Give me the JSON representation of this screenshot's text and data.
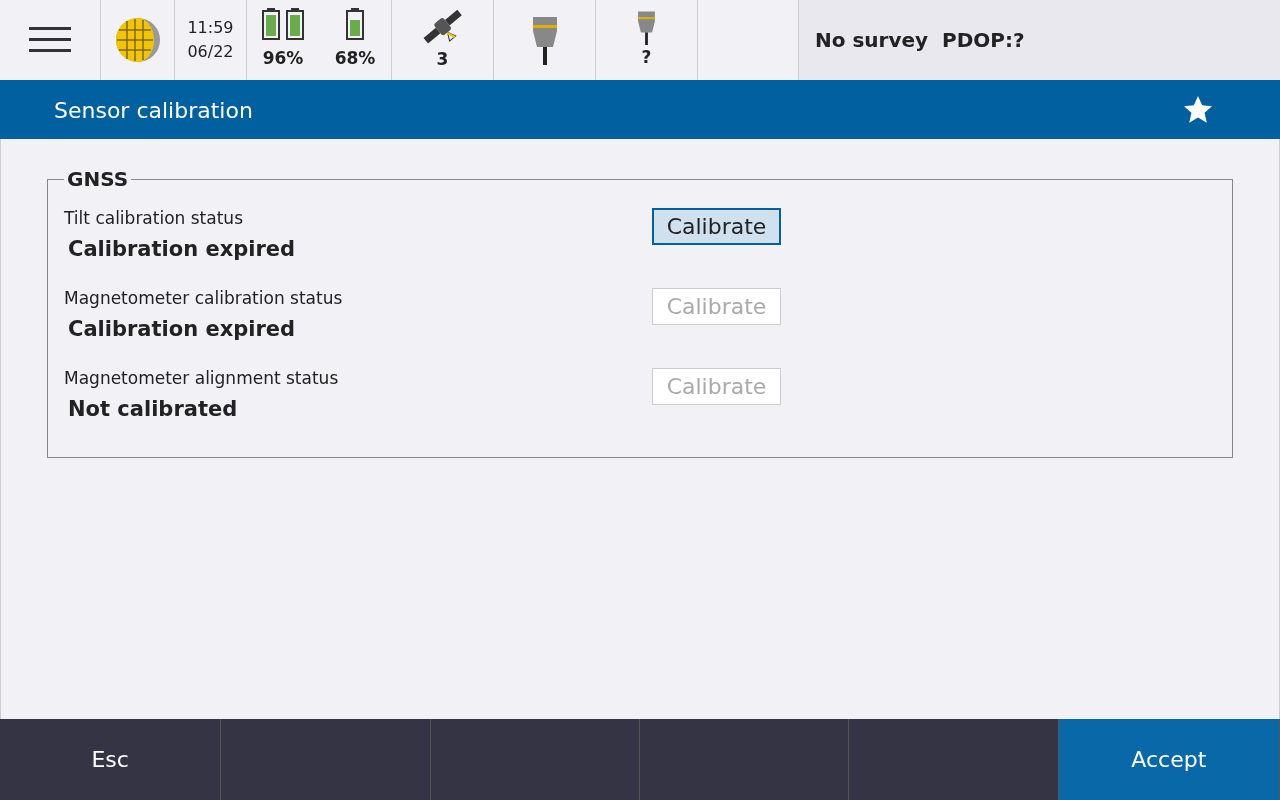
{
  "status_bar": {
    "time": "11:59",
    "date": "06/22",
    "battery_groups": [
      {
        "reading": "96%",
        "kind": "dual"
      },
      {
        "reading": "68%",
        "kind": "single"
      }
    ],
    "satellites": "3",
    "receiver_2": "?",
    "survey_status": "No survey  PDOP:?"
  },
  "title_bar": {
    "title": "Sensor calibration",
    "favorite": true
  },
  "group": {
    "title": "GNSS",
    "rows": [
      {
        "label": "Tilt calibration status",
        "value": "Calibration expired",
        "button": "Calibrate",
        "disabled": false,
        "focused": true
      },
      {
        "label": "Magnetometer calibration status",
        "value": "Calibration expired",
        "button": "Calibrate",
        "disabled": true,
        "focused": false
      },
      {
        "label": "Magnetometer alignment status",
        "value": "Not calibrated",
        "button": "Calibrate",
        "disabled": true,
        "focused": false
      }
    ]
  },
  "footer": [
    {
      "label": "Esc",
      "kind": "plain"
    },
    {
      "kind": "empty"
    },
    {
      "kind": "empty"
    },
    {
      "kind": "empty"
    },
    {
      "kind": "empty"
    },
    {
      "label": "Accept",
      "kind": "primary"
    }
  ]
}
